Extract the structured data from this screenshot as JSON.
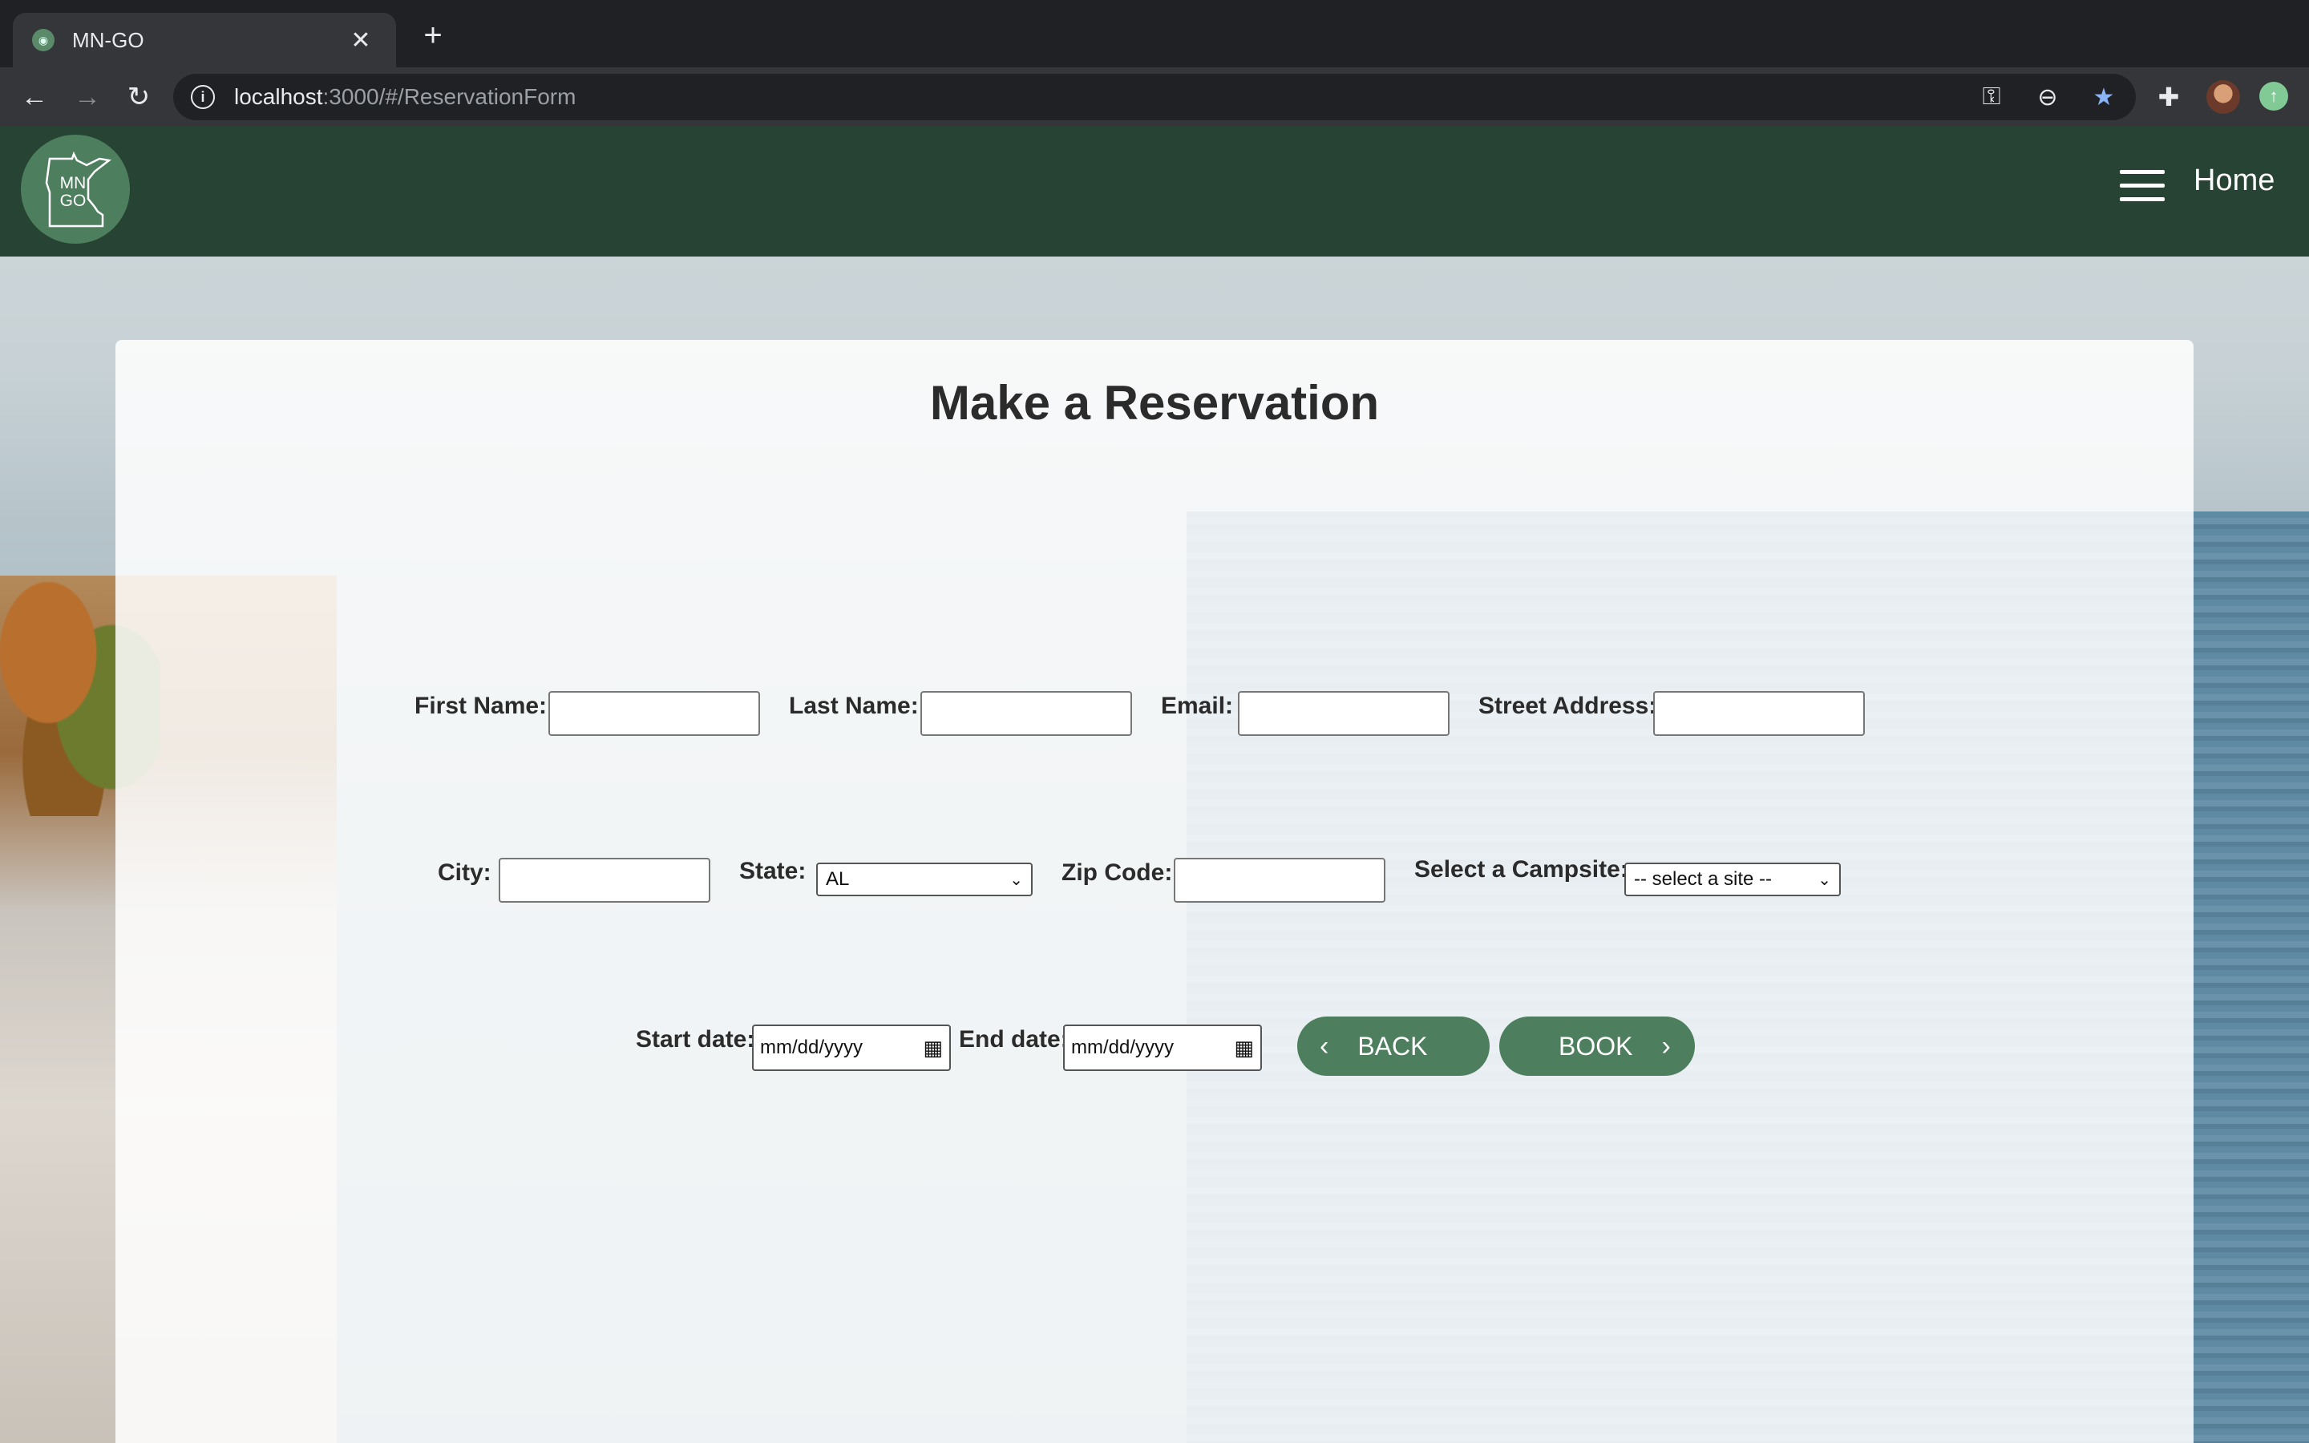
{
  "browser": {
    "tab_title": "MN-GO",
    "tab_close": "✕",
    "new_tab": "+",
    "url_host": "localhost",
    "url_rest": ":3000/#/ReservationForm"
  },
  "site": {
    "logo_text_line1": "MN",
    "logo_text_line2": "GO",
    "nav_home": "Home"
  },
  "form": {
    "title": "Make a Reservation",
    "first_name_label": "First Name:",
    "last_name_label": "Last Name:",
    "email_label": "Email:",
    "street_label": "Street Address:",
    "city_label": "City:",
    "state_label": "State:",
    "state_value": "AL",
    "zip_label": "Zip Code:",
    "campsite_label": "Select a Campsite:",
    "campsite_value": "-- select a site --",
    "start_label": "Start date:",
    "start_placeholder": "mm/dd/yyyy",
    "end_label": "End date:",
    "end_placeholder": "mm/dd/yyyy",
    "back_label": "BACK",
    "book_label": "BOOK"
  },
  "colors": {
    "navbar": "#264333",
    "accent": "#4d7e5d"
  }
}
